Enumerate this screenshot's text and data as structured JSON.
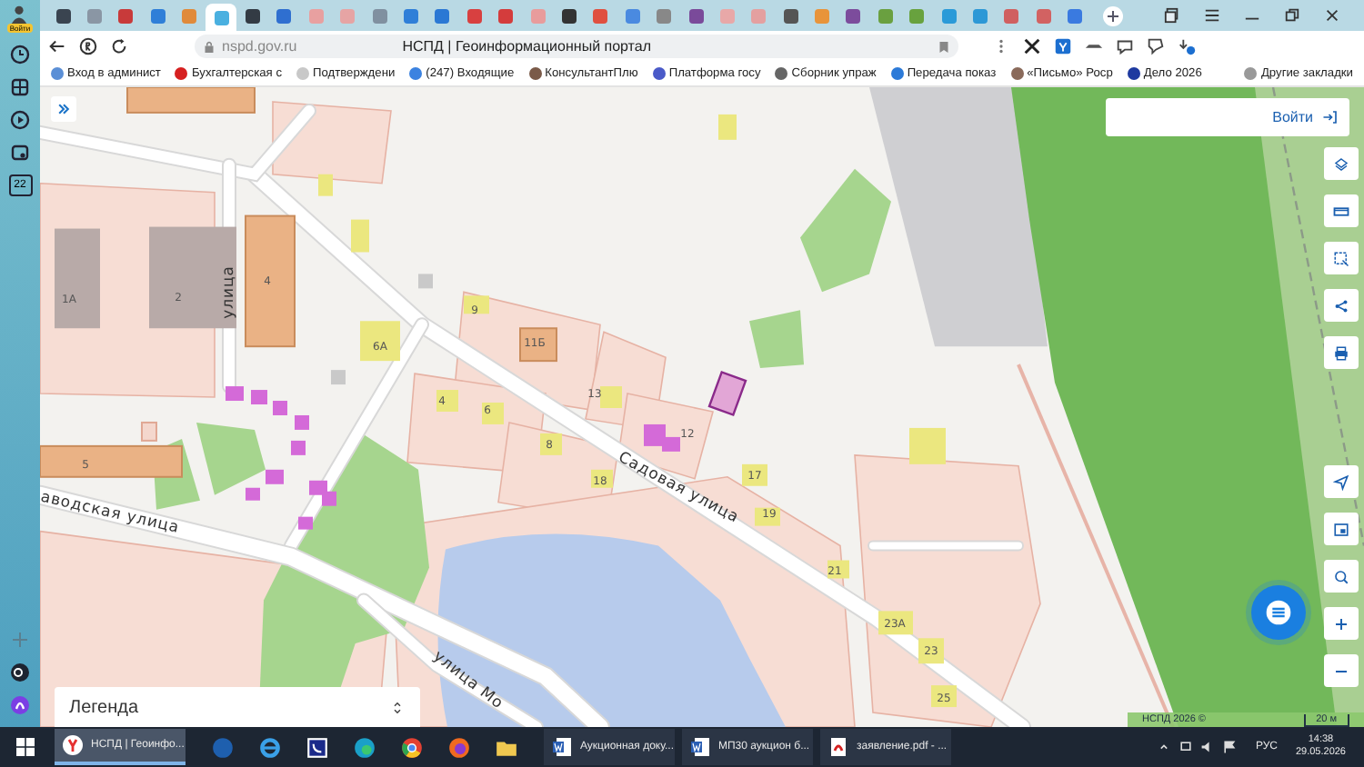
{
  "browser_sidebar": {
    "profile_badge": "Войти",
    "calendar_day": "22"
  },
  "tabs": [
    {
      "color": "#3a4450",
      "selected": false
    },
    {
      "color": "#8a96a4",
      "selected": false
    },
    {
      "color": "#c83a3a",
      "selected": false
    },
    {
      "color": "#2f7fd8",
      "selected": false
    },
    {
      "color": "#e08a3a",
      "selected": false
    },
    {
      "color": "#4ab0e0",
      "selected": true
    },
    {
      "color": "#333b44",
      "selected": false
    },
    {
      "color": "#2f6fd0",
      "selected": false
    },
    {
      "color": "#e8a0a0",
      "selected": false
    },
    {
      "color": "#e6a4a4",
      "selected": false
    },
    {
      "color": "#8090a0",
      "selected": false
    },
    {
      "color": "#2f7fd8",
      "selected": false
    },
    {
      "color": "#2b78d4",
      "selected": false
    },
    {
      "color": "#d84040",
      "selected": false
    },
    {
      "color": "#d43c3c",
      "selected": false
    },
    {
      "color": "#e89c9c",
      "selected": false
    },
    {
      "color": "#333333",
      "selected": false
    },
    {
      "color": "#e05040",
      "selected": false
    },
    {
      "color": "#4a8ae0",
      "selected": false
    },
    {
      "color": "#888888",
      "selected": false
    },
    {
      "color": "#7a4a9a",
      "selected": false
    },
    {
      "color": "#e8a8a8",
      "selected": false
    },
    {
      "color": "#e4a0a0",
      "selected": false
    },
    {
      "color": "#555555",
      "selected": false
    },
    {
      "color": "#e8943a",
      "selected": false
    },
    {
      "color": "#7c4c9c",
      "selected": false
    },
    {
      "color": "#6aa040",
      "selected": false
    },
    {
      "color": "#68a23e",
      "selected": false
    },
    {
      "color": "#2a9ad8",
      "selected": false
    },
    {
      "color": "#2c98d6",
      "selected": false
    },
    {
      "color": "#d06060",
      "selected": false
    },
    {
      "color": "#d26262",
      "selected": false
    },
    {
      "color": "#3a7ae0",
      "selected": false
    }
  ],
  "address_bar": {
    "url": "nspd.gov.ru",
    "page_title": "НСПД | Геоинформационный портал"
  },
  "bookmarks": [
    {
      "label": "Вход в админист",
      "color": "#5b8fd6"
    },
    {
      "label": "Бухгалтерская с",
      "color": "#d62020"
    },
    {
      "label": "Подтверждени",
      "color": "#c8c8c8"
    },
    {
      "label": "(247) Входящие",
      "color": "#3b82e0"
    },
    {
      "label": "КонсультантПлю",
      "color": "#7a5a48"
    },
    {
      "label": "Платформа госу",
      "color": "#4a5ac8"
    },
    {
      "label": "Сборник упраж",
      "color": "#666666"
    },
    {
      "label": "Передача показ",
      "color": "#2c7ad8"
    },
    {
      "label": "«Письмо» Роср",
      "color": "#8a6a5a"
    },
    {
      "label": "Дело 2026",
      "color": "#1e3aa0"
    },
    {
      "label": "Другие закладки",
      "color": "#999999"
    }
  ],
  "map": {
    "login_button": "Войти",
    "legend": "Легенда",
    "streets": [
      {
        "label": "аводская улица"
      },
      {
        "label": "Садовая улица"
      },
      {
        "label": "улица"
      },
      {
        "label": "улица Мо"
      }
    ],
    "house_numbers": [
      "1А",
      "2",
      "4",
      "5",
      "6А",
      "9",
      "11Б",
      "13",
      "4",
      "6",
      "8",
      "18",
      "12",
      "17",
      "19",
      "21",
      "23А",
      "23",
      "25"
    ],
    "attribution": "НСПД 2026 ©",
    "scale": "20 м"
  },
  "taskbar": {
    "items": [
      {
        "label": "НСПД | Геоинфо...",
        "kind": "browser",
        "selected": true
      },
      {
        "label": "Аукционная доку...",
        "kind": "word",
        "selected": false
      },
      {
        "label": "МП30 аукцион б...",
        "kind": "word",
        "selected": false
      },
      {
        "label": "заявление.pdf - ...",
        "kind": "pdf",
        "selected": false
      }
    ],
    "language": "РУС",
    "time": "14:38",
    "date": "29.05.2026"
  }
}
